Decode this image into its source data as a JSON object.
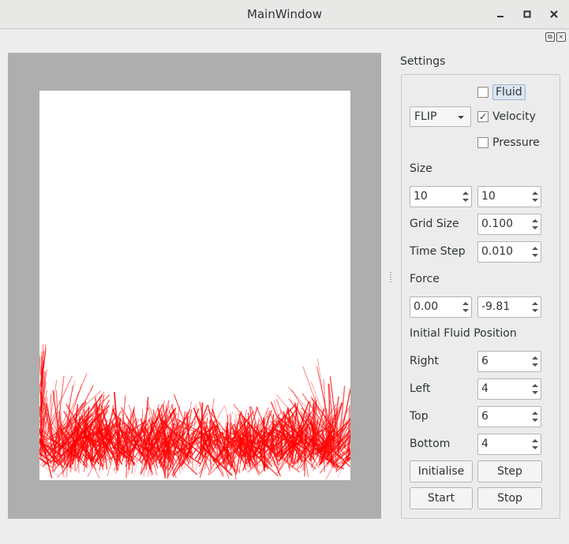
{
  "window": {
    "title": "MainWindow"
  },
  "titlebar_icons": {
    "minimize": "minimize-icon",
    "maximize": "maximize-icon",
    "close": "close-icon"
  },
  "dock_icons": {
    "float": "dock-float-icon",
    "close": "dock-close-icon"
  },
  "settings": {
    "title": "Settings",
    "method": "FLIP",
    "fluid": {
      "label": "Fluid",
      "checked": false
    },
    "velocity": {
      "label": "Velocity",
      "checked": true
    },
    "pressure": {
      "label": "Pressure",
      "checked": false
    },
    "size_label": "Size",
    "size_x": "10",
    "size_y": "10",
    "grid_size_label": "Grid Size",
    "grid_size": "0.100",
    "time_step_label": "Time Step",
    "time_step": "0.010",
    "force_label": "Force",
    "force_x": "0.00",
    "force_y": "-9.81",
    "initial_fluid_label": "Initial Fluid Position",
    "right_label": "Right",
    "right": "6",
    "left_label": "Left",
    "left": "4",
    "top_label": "Top",
    "top": "6",
    "bottom_label": "Bottom",
    "bottom": "4"
  },
  "buttons": {
    "initialise": "Initialise",
    "step": "Step",
    "start": "Start",
    "stop": "Stop"
  },
  "colors": {
    "velocity": "#ff0000",
    "canvas_bg": "#aeaeae",
    "sim_bg": "#ffffff"
  }
}
